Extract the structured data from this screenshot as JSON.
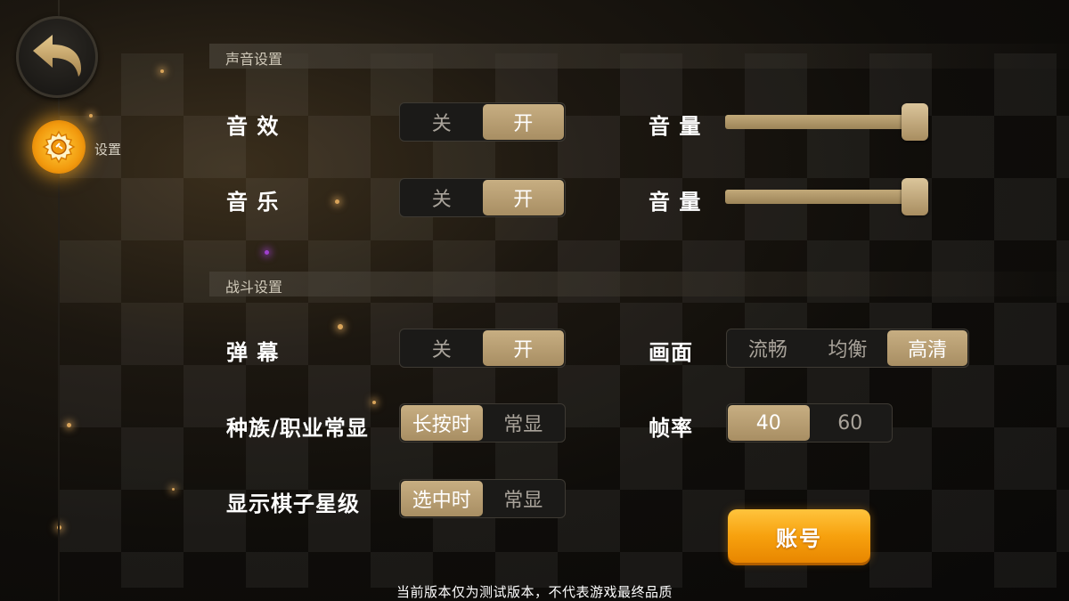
{
  "nav": {
    "back_icon": "back-arrow-icon",
    "settings_icon": "gear-icon",
    "settings_label": "设置"
  },
  "sections": {
    "sound": "声音设置",
    "battle": "战斗设置"
  },
  "sound": {
    "effects": {
      "label": "音 效",
      "off": "关",
      "on": "开",
      "selected": "开"
    },
    "effects_volume": {
      "label": "音 量",
      "value": 1.0
    },
    "music": {
      "label": "音 乐",
      "off": "关",
      "on": "开",
      "selected": "开"
    },
    "music_volume": {
      "label": "音 量",
      "value": 1.0
    }
  },
  "battle": {
    "danmaku": {
      "label": "弹 幕",
      "off": "关",
      "on": "开",
      "selected": "开"
    },
    "race_class": {
      "label": "种族/职业常显",
      "opt1": "长按时",
      "opt2": "常显",
      "selected": "长按时"
    },
    "star_level": {
      "label": "显示棋子星级",
      "opt1": "选中时",
      "opt2": "常显",
      "selected": "选中时"
    },
    "quality": {
      "label": "画面",
      "opt1": "流畅",
      "opt2": "均衡",
      "opt3": "高清",
      "selected": "高清"
    },
    "framerate": {
      "label": "帧率",
      "opt1": "40",
      "opt2": "60",
      "selected": "40"
    }
  },
  "account_button": "账号",
  "footer_note": "当前版本仅为测试版本，不代表游戏最终品质",
  "colors": {
    "accent_gold": "#b89c6e",
    "account_orange": "#f7a10e",
    "glow_orange": "#ffaa1e"
  }
}
